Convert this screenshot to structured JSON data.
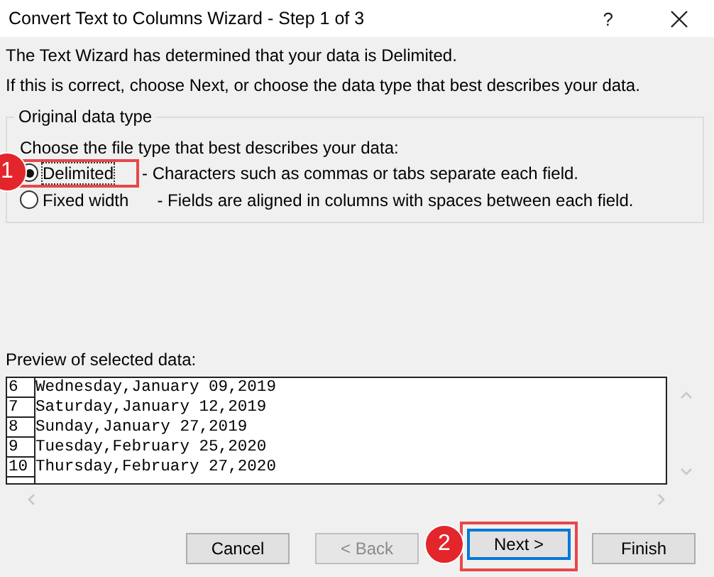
{
  "window": {
    "title": "Convert Text to Columns Wizard - Step 1 of 3",
    "help": "?"
  },
  "intro": [
    "The Text Wizard has determined that your data is Delimited.",
    "If this is correct, choose Next, or choose the data type that best describes your data."
  ],
  "group": {
    "legend": "Original data type",
    "prompt": "Choose the file type that best describes your data:",
    "options": [
      {
        "label": "Delimited",
        "description": "- Characters such as commas or tabs separate each field.",
        "selected": true,
        "callout": "1"
      },
      {
        "label": "Fixed width",
        "description": "- Fields are aligned in columns with spaces between each field.",
        "selected": false
      }
    ]
  },
  "preview": {
    "label": "Preview of selected data:",
    "rows": [
      {
        "number": "6",
        "text": "Wednesday,January 09,2019"
      },
      {
        "number": "7",
        "text": "Saturday,January 12,2019"
      },
      {
        "number": "8",
        "text": "Sunday,January 27,2019"
      },
      {
        "number": "9",
        "text": "Tuesday,February 25,2020"
      },
      {
        "number": "10",
        "text": "Thursday,February 27,2020"
      }
    ]
  },
  "buttons": [
    {
      "label": "Cancel",
      "disabled": false,
      "default": false
    },
    {
      "label": "< Back",
      "disabled": true,
      "default": false
    },
    {
      "label": "Next >",
      "disabled": false,
      "default": true,
      "callout": "2"
    },
    {
      "label": "Finish",
      "disabled": false,
      "default": false
    }
  ]
}
